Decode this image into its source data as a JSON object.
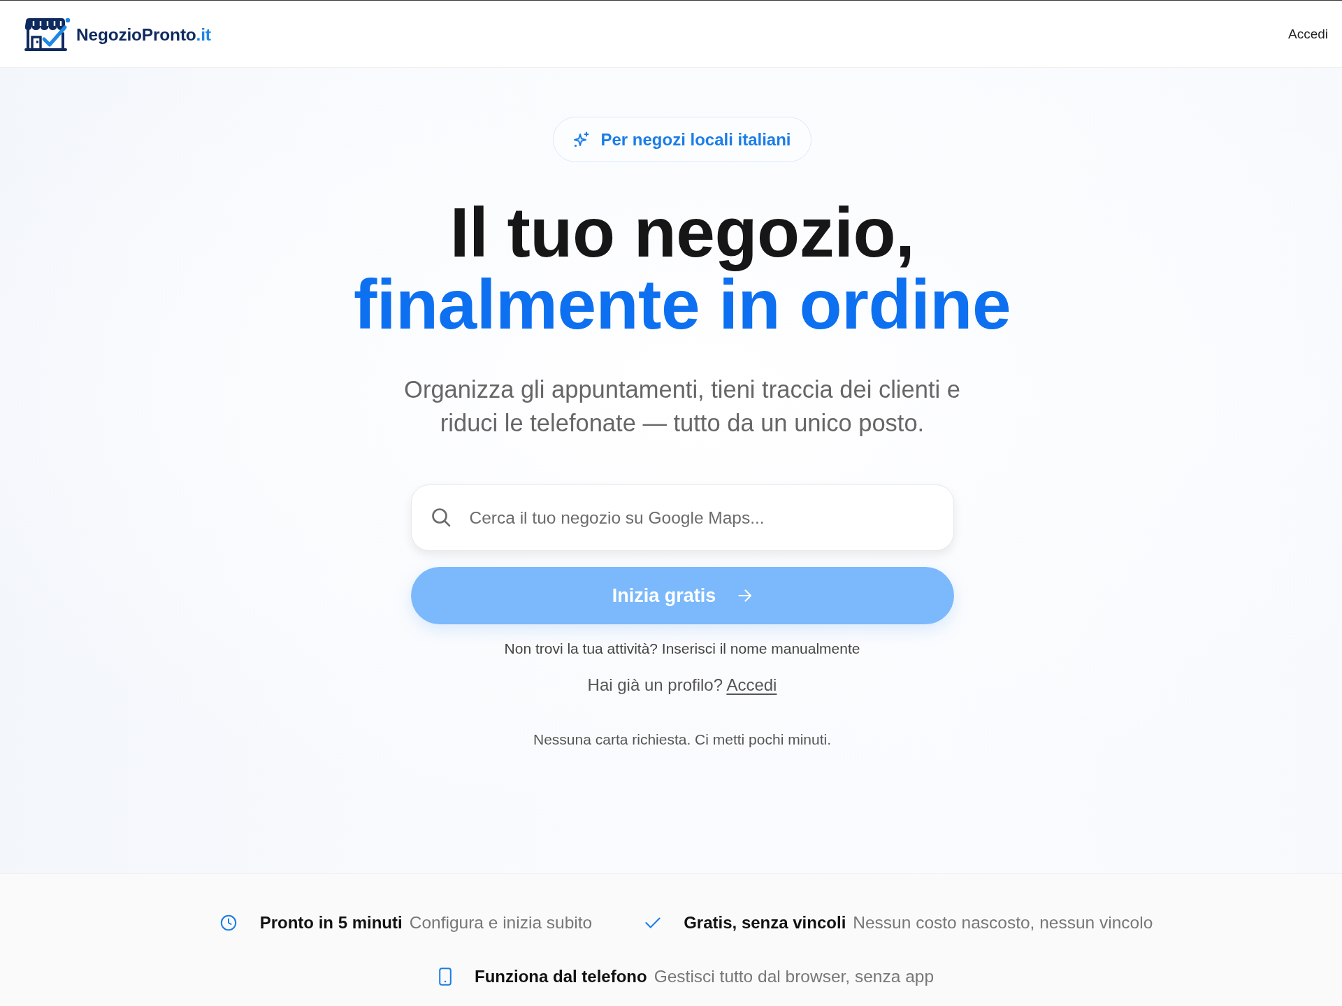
{
  "header": {
    "logo": {
      "name": "NegozioPronto",
      "suffix": ".it"
    },
    "login_link": "Accedi"
  },
  "hero": {
    "badge": "Per negozi locali italiani",
    "headline": {
      "line_1": "Il tuo negozio,",
      "line_2": "finalmente in ordine"
    },
    "subtitle": "Organizza gli appuntamenti, tieni traccia dei clienti e riduci le telefonate — tutto da un unico posto.",
    "search": {
      "placeholder": "Cerca il tuo negozio su Google Maps..."
    },
    "cta_button": {
      "label": "Inizia gratis",
      "disabled": true
    },
    "manual_entry_link": "Non trovi la tua attività? Inserisci il nome manualmente",
    "login_prompt": {
      "text": "Hai già un profilo?",
      "link": "Accedi"
    },
    "note": "Nessuna carta richiesta. Ci metti pochi minuti."
  },
  "features": [
    {
      "kind": "setup",
      "title": "Pronto in 5 minuti",
      "description": "Configura e inizia subito"
    },
    {
      "kind": "pricing",
      "title": "Gratis, senza vincoli",
      "description": "Nessun costo nascosto, nessun vincolo"
    },
    {
      "kind": "mobile",
      "title": "Funziona dal telefono",
      "description": "Gestisci tutto dal browser, senza app"
    }
  ]
}
